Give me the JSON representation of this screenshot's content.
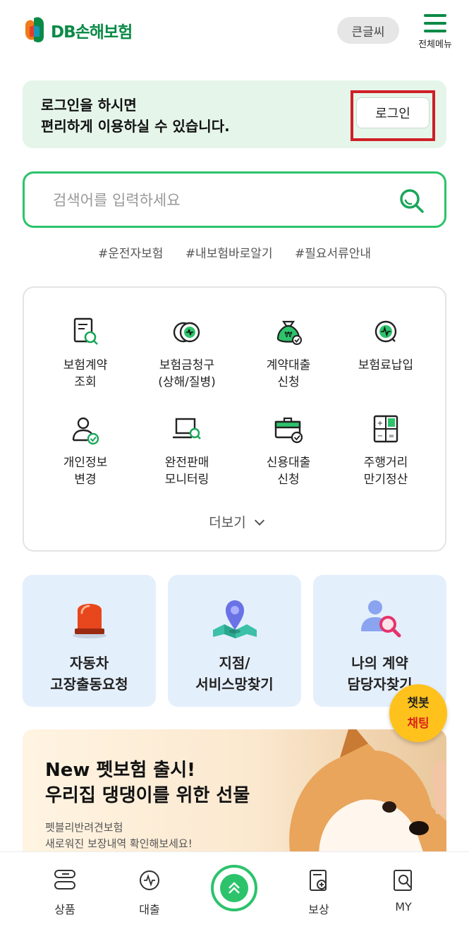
{
  "header": {
    "logo_text": "DB손해보험",
    "font_size_button": "큰글씨",
    "menu_label": "전체메뉴"
  },
  "login_banner": {
    "line1": "로그인을 하시면",
    "line2": "편리하게 이용하실 수 있습니다.",
    "button_label": "로그인"
  },
  "search": {
    "placeholder": "검색어를 입력하세요",
    "hashtags": [
      "#운전자보험",
      "#내보험바로알기",
      "#필요서류안내"
    ]
  },
  "menu_grid": {
    "items": [
      {
        "label": "보험계약\n조회",
        "icon": "document-search-icon"
      },
      {
        "label": "보험금청구\n(상해/질병)",
        "icon": "coin-claim-icon"
      },
      {
        "label": "계약대출\n신청",
        "icon": "money-bag-icon"
      },
      {
        "label": "보험료납입",
        "icon": "payment-icon"
      },
      {
        "label": "개인정보\n변경",
        "icon": "user-check-icon"
      },
      {
        "label": "완전판매\n모니터링",
        "icon": "laptop-search-icon"
      },
      {
        "label": "신용대출\n신청",
        "icon": "briefcase-check-icon"
      },
      {
        "label": "주행거리\n만기정산",
        "icon": "calculator-icon"
      }
    ],
    "more_label": "더보기"
  },
  "quick_cards": [
    {
      "label": "자동차\n고장출동요청",
      "icon": "siren-icon"
    },
    {
      "label": "지점/\n서비스망찾기",
      "icon": "map-pin-icon"
    },
    {
      "label": "나의 계약\n담당자찾기",
      "icon": "person-search-icon"
    }
  ],
  "chatbot": {
    "line1": "챗봇",
    "line2": "채팅"
  },
  "promo": {
    "title": "New 펫보험 출시!\n우리집 댕댕이를 위한 선물",
    "subtitle": "펫블리반려견보험\n새로워진 보장내역 확인해보세요!"
  },
  "bottom_nav": {
    "items": [
      {
        "label": "상품",
        "icon": "product-icon"
      },
      {
        "label": "대출",
        "icon": "loan-icon"
      },
      {
        "label": "",
        "icon": "scroll-top-icon"
      },
      {
        "label": "보상",
        "icon": "claim-icon"
      },
      {
        "label": "MY",
        "icon": "my-icon"
      }
    ]
  },
  "colors": {
    "brand_green": "#0b8a47",
    "accent_green": "#2cc36b",
    "highlight_red": "#d01f25",
    "chatbot_yellow": "#ffc21c"
  }
}
